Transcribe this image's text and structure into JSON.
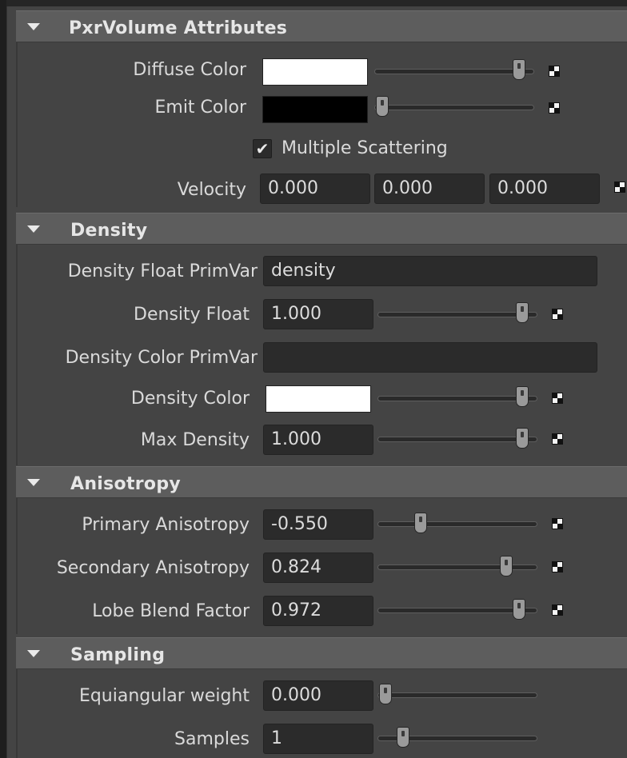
{
  "sections": {
    "pxr_volume": {
      "title": "PxrVolume Attributes",
      "diffuse_color": {
        "label": "Diffuse Color",
        "color": "#ffffff",
        "slider": 0.94
      },
      "emit_color": {
        "label": "Emit Color",
        "color": "#000000",
        "slider": 0.0
      },
      "multiple_scattering": {
        "label": "Multiple Scattering",
        "checked": true,
        "mark": "✔"
      },
      "velocity": {
        "label": "Velocity",
        "x": "0.000",
        "y": "0.000",
        "z": "0.000"
      }
    },
    "density": {
      "title": "Density",
      "density_float_primvar": {
        "label": "Density Float PrimVar",
        "value": "density"
      },
      "density_float": {
        "label": "Density Float",
        "value": "1.000",
        "slider": 0.94
      },
      "density_color_primvar": {
        "label": "Density Color PrimVar",
        "value": ""
      },
      "density_color": {
        "label": "Density Color",
        "color": "#ffffff",
        "slider": 0.94
      },
      "max_density": {
        "label": "Max Density",
        "value": "1.000",
        "slider": 0.94
      }
    },
    "anisotropy": {
      "title": "Anisotropy",
      "primary": {
        "label": "Primary Anisotropy",
        "value": "-0.550",
        "slider": 0.24
      },
      "secondary": {
        "label": "Secondary Anisotropy",
        "value": "0.824",
        "slider": 0.83
      },
      "lobe_blend": {
        "label": "Lobe Blend Factor",
        "value": "0.972",
        "slider": 0.92
      }
    },
    "sampling": {
      "title": "Sampling",
      "equiangular_weight": {
        "label": "Equiangular weight",
        "value": "0.000",
        "slider": 0.0
      },
      "samples": {
        "label": "Samples",
        "value": "1",
        "slider": 0.12
      }
    }
  },
  "icons": {
    "collapse": "triangle-down-icon",
    "map": "checker-map-icon",
    "slider_handle": "slider-handle-icon"
  },
  "colors": {
    "background": "#444444",
    "header": "#5d5d5d",
    "field": "#2b2b2b",
    "text": "#dadada"
  }
}
